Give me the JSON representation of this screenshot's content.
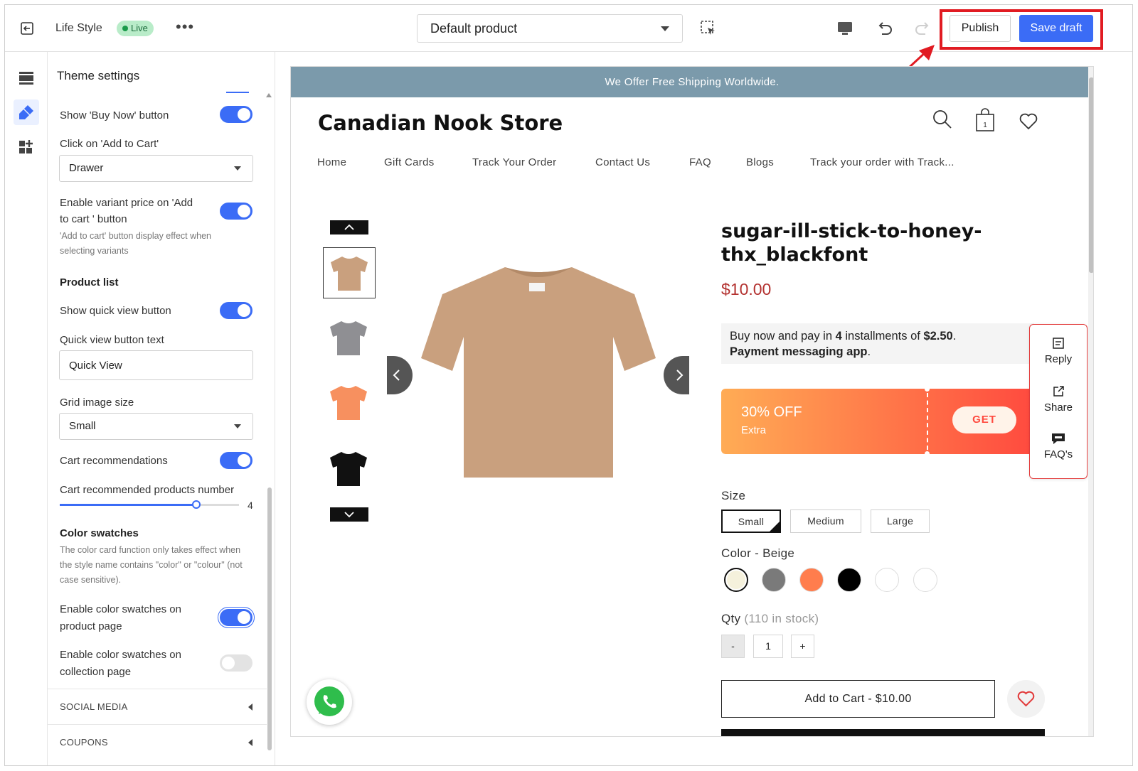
{
  "topbar": {
    "store_name": "Life Style",
    "status": "Live",
    "more": "•••",
    "template_select": "Default product",
    "publish_label": "Publish",
    "save_label": "Save draft"
  },
  "settings": {
    "title": "Theme settings",
    "buy_now_label": "Show 'Buy Now' button",
    "add_to_cart_click_label": "Click on 'Add to Cart'",
    "add_to_cart_click_value": "Drawer",
    "variant_price_label_1": "Enable variant price on 'Add",
    "variant_price_label_2": "to cart ' button",
    "variant_price_help_1": "'Add to cart' button display effect when",
    "variant_price_help_2": "selecting variants",
    "product_list_heading": "Product list",
    "quick_view_label": "Show quick view button",
    "quick_view_text_label": "Quick view button text",
    "quick_view_text_value": "Quick View",
    "grid_image_size_label": "Grid image size",
    "grid_image_size_value": "Small",
    "cart_recs_label": "Cart recommendations",
    "cart_recs_number_label": "Cart recommended products number",
    "cart_recs_number_value": "4",
    "cart_recs_slider_fraction": 0.76,
    "color_swatches_heading": "Color swatches",
    "color_swatches_help_1": "The color card function only takes effect when",
    "color_swatches_help_2": "the style name contains \"color\" or \"colour\" (not",
    "color_swatches_help_3": "case sensitive).",
    "swatch_product_label_1": "Enable color swatches on",
    "swatch_product_label_2": "product page",
    "swatch_collection_label_1": "Enable color swatches on",
    "swatch_collection_label_2": "collection page",
    "social_media": "SOCIAL MEDIA",
    "coupons": "COUPONS",
    "toggles": {
      "buy_now": true,
      "variant_price": true,
      "quick_view": true,
      "cart_recs": true,
      "swatch_product": true,
      "swatch_collection": false
    }
  },
  "preview": {
    "announcement": "We Offer Free Shipping Worldwide.",
    "store_title": "Canadian Nook Store",
    "cart_count": "1",
    "nav": [
      "Home",
      "Gift Cards",
      "Track Your Order",
      "Contact Us",
      "FAQ",
      "Blogs",
      "Track your order with Track..."
    ],
    "product_title_1": "sugar-ill-stick-to-honey-",
    "product_title_2": "thx_blackfont",
    "price": "$10.00",
    "pay_text_1": "Buy now and pay in ",
    "pay_installments": "4",
    "pay_text_2": " installments of ",
    "pay_amount": "$2.50",
    "pay_text_3": ".",
    "pay_app": "Payment messaging app",
    "pay_text_4": ".",
    "coupon_off": "30% OFF",
    "coupon_extra": "Extra",
    "coupon_get": "GET",
    "size_label": "Size",
    "sizes": [
      "Small",
      "Medium",
      "Large"
    ],
    "color_label": "Color - Beige",
    "colors": [
      "#f5f1dc",
      "#7a7a7a",
      "#ff7d4d",
      "#000000",
      "#ffffff",
      "#ffffff"
    ],
    "qty_label": "Qty",
    "qty_stock": "(110 in stock)",
    "qty_minus": "-",
    "qty_value": "1",
    "qty_plus": "+",
    "add_to_cart": "Add to Cart - $10.00",
    "thumb_colors": [
      "#c9a07e",
      "#8f8f93",
      "#f7905f",
      "#111111"
    ],
    "side_widget": {
      "reply": "Reply",
      "share": "Share",
      "faq": "FAQ's"
    }
  },
  "colors": {
    "accent": "#3b6cf6",
    "highlight": "#e11b22",
    "announcement_bg": "#7b9aab",
    "price": "#b3312f"
  }
}
